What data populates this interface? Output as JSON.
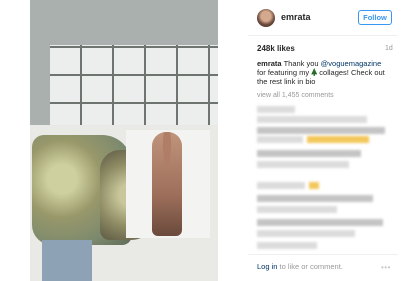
{
  "post": {
    "username": "emrata",
    "follow_label": "Follow",
    "likes": "248k likes",
    "timestamp": "1d",
    "caption": {
      "user": "emrata",
      "text_before_mention": "Thank you ",
      "mention": "@voguemagazine",
      "text_after_mention": " for featuring my ",
      "icon": "christmas-tree-icon",
      "text_after_icon": " collages! Check out the rest link in bio"
    },
    "view_comments": "view all 1,455 comments",
    "login_prompt": {
      "login_link": "Log in",
      "rest": " to like or comment."
    },
    "more_icon": "•••"
  },
  "colors": {
    "accent": "#3897f0",
    "link": "#003569",
    "text": "#262626",
    "muted": "#999999"
  }
}
